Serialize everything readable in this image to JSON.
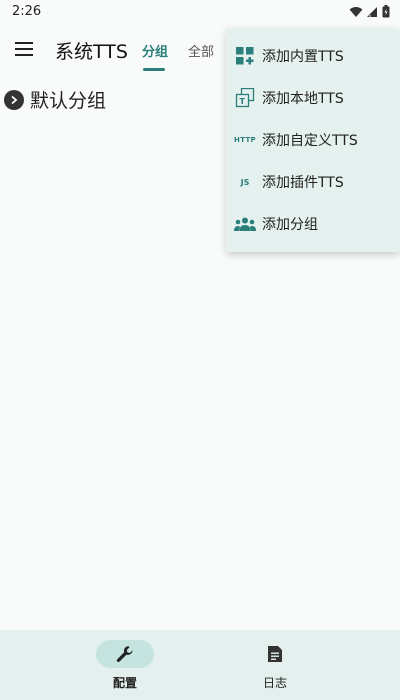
{
  "status_bar": {
    "time": "2:26"
  },
  "app_bar": {
    "title": "系统TTS",
    "tabs": [
      {
        "label": "分组",
        "selected": true
      },
      {
        "label": "全部",
        "selected": false
      }
    ]
  },
  "groups": [
    {
      "label": "默认分组",
      "expanded": false
    }
  ],
  "dropdown_menu": {
    "items": [
      {
        "label": "添加内置TTS",
        "icon": "grid-add-icon"
      },
      {
        "label": "添加本地TTS",
        "icon": "local-tts-icon"
      },
      {
        "label": "添加自定义TTS",
        "icon": "http-icon",
        "icon_text": "HTTP"
      },
      {
        "label": "添加插件TTS",
        "icon": "js-icon",
        "icon_text": "JS"
      },
      {
        "label": "添加分组",
        "icon": "group-icon"
      }
    ]
  },
  "bottom_nav": {
    "items": [
      {
        "label": "配置",
        "icon": "wrench-icon",
        "selected": true
      },
      {
        "label": "日志",
        "icon": "document-icon",
        "selected": false
      }
    ]
  },
  "colors": {
    "accent": "#2a7f7a",
    "background": "#f8fbfa",
    "menu_background": "#e4f1ef",
    "nav_background": "#e3f0ee",
    "nav_pill": "#c5e4e0"
  }
}
